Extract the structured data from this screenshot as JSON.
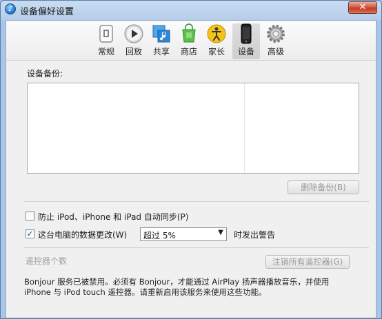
{
  "window": {
    "title": "设备偏好设置",
    "close_glyph": "✕"
  },
  "toolbar": {
    "items": [
      {
        "label": "常规",
        "icon": "general-icon"
      },
      {
        "label": "回放",
        "icon": "playback-icon"
      },
      {
        "label": "共享",
        "icon": "sharing-icon"
      },
      {
        "label": "商店",
        "icon": "store-icon"
      },
      {
        "label": "家长",
        "icon": "parental-icon"
      },
      {
        "label": "设备",
        "icon": "devices-icon",
        "selected": true
      },
      {
        "label": "高级",
        "icon": "advanced-icon"
      }
    ]
  },
  "backups": {
    "label": "设备备份:",
    "delete_button": "删除备份(B)"
  },
  "options": {
    "prevent_sync": {
      "label": "防止 iPod、iPhone 和 iPad 自动同步(P)",
      "checked": false
    },
    "warn_data": {
      "label": "这台电脑的数据更改(W)",
      "checked": true,
      "select_value": "超过 5%",
      "after": "时发出警告"
    }
  },
  "remotes": {
    "label": "遥控器个数",
    "forget_button": "注销所有遥控器(G)"
  },
  "info": {
    "line1": "Bonjour 服务已被禁用。必须有 Bonjour，才能通过 AirPlay 扬声器播放音乐，并使用",
    "line2": "iPhone 与 iPod touch 遥控器。请重新启用该服务来使用这些功能。"
  }
}
